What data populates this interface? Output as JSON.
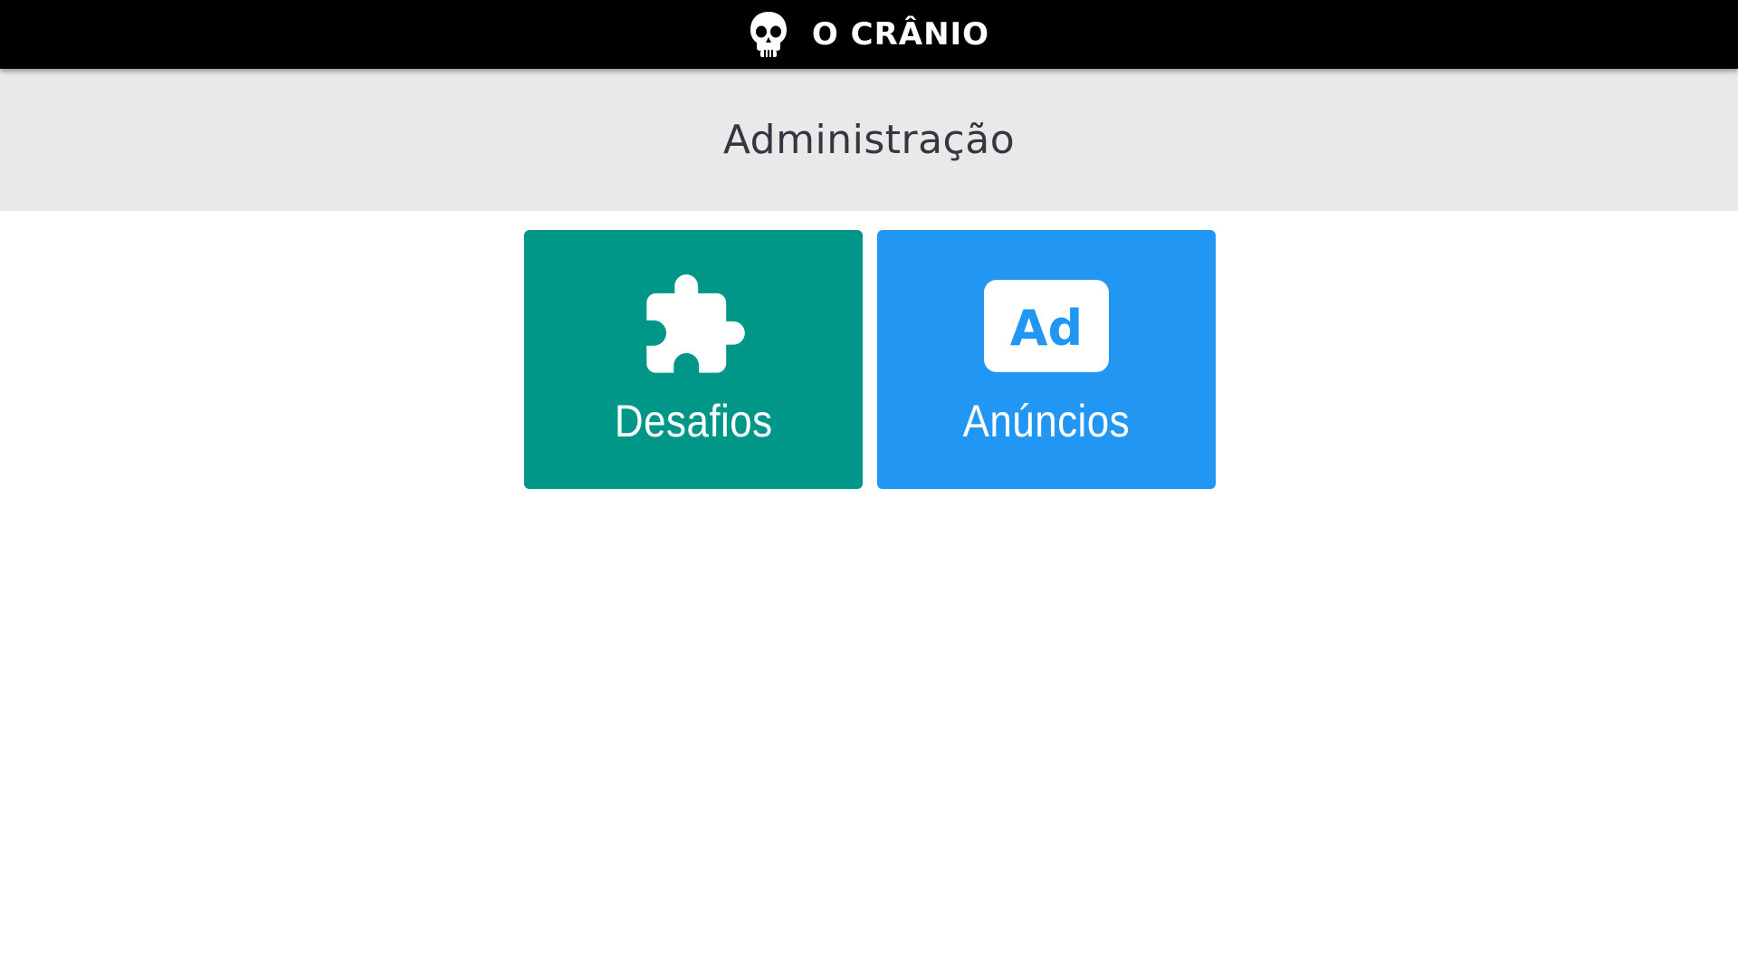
{
  "topbar": {
    "brand_text": "O CRÂNIO",
    "logo_icon": "skull-icon"
  },
  "header": {
    "title": "Administração"
  },
  "tiles": [
    {
      "label": "Desafios",
      "icon": "puzzle-piece-icon",
      "color": "#009688"
    },
    {
      "label": "Anúncios",
      "icon": "ad-badge-icon",
      "icon_text": "Ad",
      "color": "#2196f3"
    }
  ]
}
